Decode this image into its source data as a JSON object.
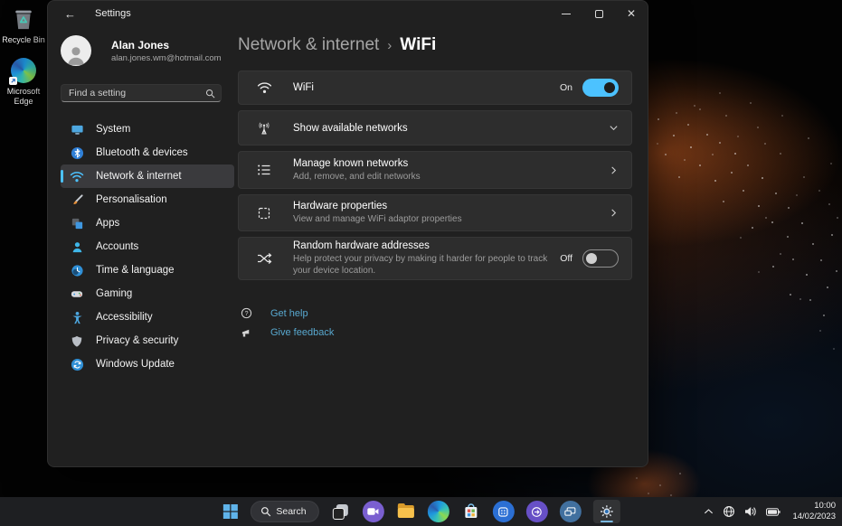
{
  "colors": {
    "accent": "#4cc2ff",
    "link": "#58a8cf",
    "window_bg": "#202020",
    "card_bg": "#2d2d2d",
    "taskbar_bg": "#1e1f22",
    "selected_item_bg": "#3a3a3d"
  },
  "icons": {
    "back-icon": "←",
    "search-icon": "magnifier shape",
    "minimize-icon": "horizontal bar",
    "maximize-icon": "square outline",
    "close-icon": "×",
    "breadcrumb-chevron-icon": "›",
    "chevron-right-icon": "thin right chevron",
    "chevron-down-icon": "thin down chevron",
    "wifi-icon": "wifi arcs",
    "antenna-icon": "broadcast tower",
    "list-icon": "bulleted list",
    "chip-icon": "dashed cpu square",
    "shuffle-icon": "crossing arrows",
    "help-icon": "question circle",
    "feedback-icon": "megaphone",
    "tray-chevron-up-icon": "^",
    "network-globe-icon": "globe",
    "volume-icon": "speaker",
    "battery-icon": "battery"
  },
  "desktop": {
    "icons": [
      {
        "name": "recycle-bin",
        "label": "Recycle Bin"
      },
      {
        "name": "microsoft-edge",
        "label": "Microsoft Edge"
      }
    ]
  },
  "window": {
    "title": "Settings",
    "sidebar": {
      "user": {
        "name": "Alan Jones",
        "email": "alan.jones.wm@hotmail.com"
      },
      "search": {
        "placeholder": "Find a setting"
      },
      "items": [
        {
          "label": "System",
          "selected": false
        },
        {
          "label": "Bluetooth & devices",
          "selected": false
        },
        {
          "label": "Network & internet",
          "selected": true
        },
        {
          "label": "Personalisation",
          "selected": false
        },
        {
          "label": "Apps",
          "selected": false
        },
        {
          "label": "Accounts",
          "selected": false
        },
        {
          "label": "Time & language",
          "selected": false
        },
        {
          "label": "Gaming",
          "selected": false
        },
        {
          "label": "Accessibility",
          "selected": false
        },
        {
          "label": "Privacy & security",
          "selected": false
        },
        {
          "label": "Windows Update",
          "selected": false
        }
      ]
    },
    "main": {
      "breadcrumb": {
        "parent": "Network & internet",
        "separator": "›",
        "current": "WiFi"
      },
      "rows": [
        {
          "title": "WiFi",
          "control": "toggle",
          "state": "On"
        },
        {
          "title": "Show available networks",
          "control": "expander"
        },
        {
          "title": "Manage known networks",
          "subtitle": "Add, remove, and edit networks",
          "control": "page-link"
        },
        {
          "title": "Hardware properties",
          "subtitle": "View and manage WiFi adaptor properties",
          "control": "page-link"
        },
        {
          "title": "Random hardware addresses",
          "subtitle": "Help protect your privacy by making it harder for people to track your device location.",
          "control": "toggle",
          "state": "Off"
        }
      ],
      "links": [
        {
          "label": "Get help"
        },
        {
          "label": "Give feedback"
        }
      ]
    }
  },
  "taskbar": {
    "search_label": "Search",
    "apps": [
      "start",
      "search",
      "task-view",
      "chat",
      "file-explorer",
      "edge",
      "store",
      "app-grid",
      "microsoft-365",
      "screen-connect",
      "settings"
    ],
    "active_app": "settings",
    "tray": {
      "time": "10:00",
      "date": "14/02/2023"
    }
  }
}
